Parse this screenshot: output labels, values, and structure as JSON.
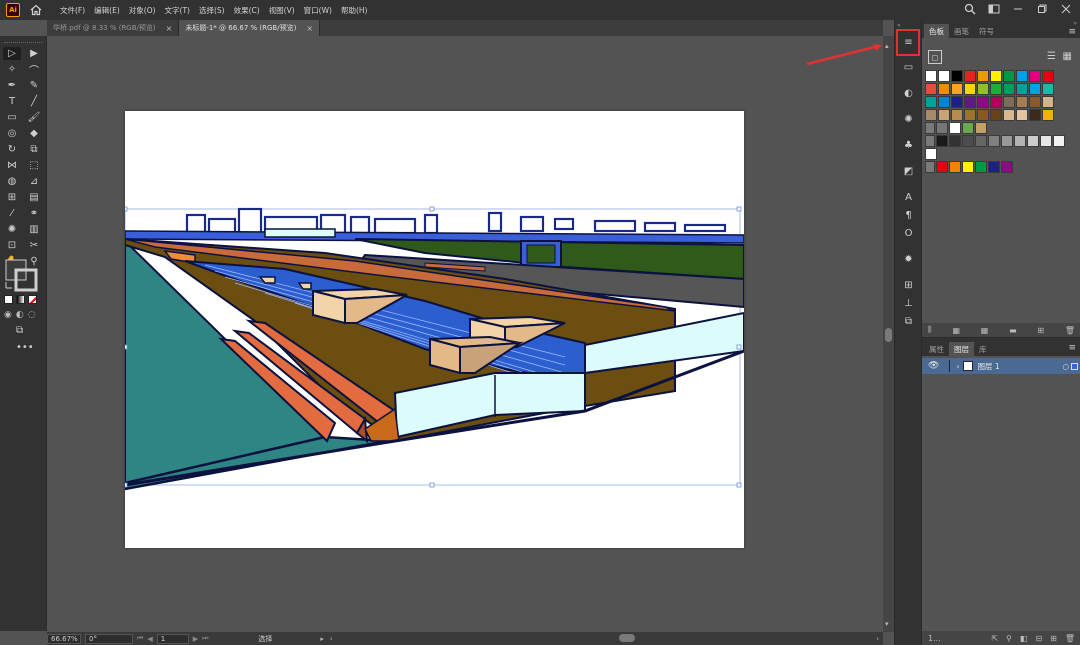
{
  "app": {
    "logo_text": "Ai"
  },
  "menus": [
    "文件(F)",
    "编辑(E)",
    "对象(O)",
    "文字(T)",
    "选择(S)",
    "效果(C)",
    "视图(V)",
    "窗口(W)",
    "帮助(H)"
  ],
  "tabs": [
    {
      "label": "华桥.pdf @ 8.33 % (RGB/预览)",
      "active": false,
      "close": "×"
    },
    {
      "label": "未标题-1* @ 66.67 % (RGB/预览)",
      "active": true,
      "close": "×"
    }
  ],
  "status": {
    "zoom": "66.67%",
    "angle": "0°",
    "page": "1",
    "mode": "选择"
  },
  "swatches_panel": {
    "tabs": [
      "色板",
      "画笔",
      "符号"
    ],
    "rows": [
      [
        "#ffffff",
        "#ffffff",
        "#000000",
        "#e52420",
        "#f39800",
        "#fff100",
        "#009944",
        "#00a0e9",
        "#e4007f",
        "#e60012"
      ],
      [
        "#e84c3d",
        "#f08c00",
        "#f5a623",
        "#f5d800",
        "#8fc31f",
        "#22ac38",
        "#009b63",
        "#00a29a",
        "#00a0e9",
        "#1eb6a4"
      ],
      [
        "#00a29a",
        "#0086d1",
        "#1d2088",
        "#601986",
        "#920783",
        "#b4005d",
        "#7e6b5a",
        "#a67c52",
        "#8b5a2b",
        "#d2b48c"
      ],
      [
        "#a68b64",
        "#c7a474",
        "#b98b50",
        "#a0702d",
        "#8a5a1a",
        "#6b4217",
        "#d6b88a",
        "#e5c3a0",
        "#3c2a1e",
        "#f3b200"
      ],
      [
        "#777777",
        "#ffffff",
        "#6aa84f",
        "#c3a06a"
      ],
      [
        "#1a1a1a",
        "#333333",
        "#4d4d4d",
        "#666666",
        "#808080",
        "#999999",
        "#b3b3b3",
        "#cccccc",
        "#e6e6e6",
        "#f2f2f2"
      ],
      [
        "#ffffff"
      ],
      [
        "#e60012",
        "#f08300",
        "#fff100",
        "#009944",
        "#1d2088",
        "#920783"
      ]
    ]
  },
  "layers_panel": {
    "tabs": [
      "属性",
      "图层",
      "库"
    ],
    "layer_name": "图层 1",
    "footer_count": "1..."
  },
  "colors": {
    "highlight": "#e33030",
    "water": "#2f8583",
    "terrace": "#6b4e10",
    "bank_orange": "#c86a3a",
    "steps_blue": "#2b5fd0",
    "light_cyan": "#dcfbfb",
    "green_strip": "#2f5a1a",
    "beige_block": "#f2d4a6",
    "outline": "#0b1240"
  }
}
